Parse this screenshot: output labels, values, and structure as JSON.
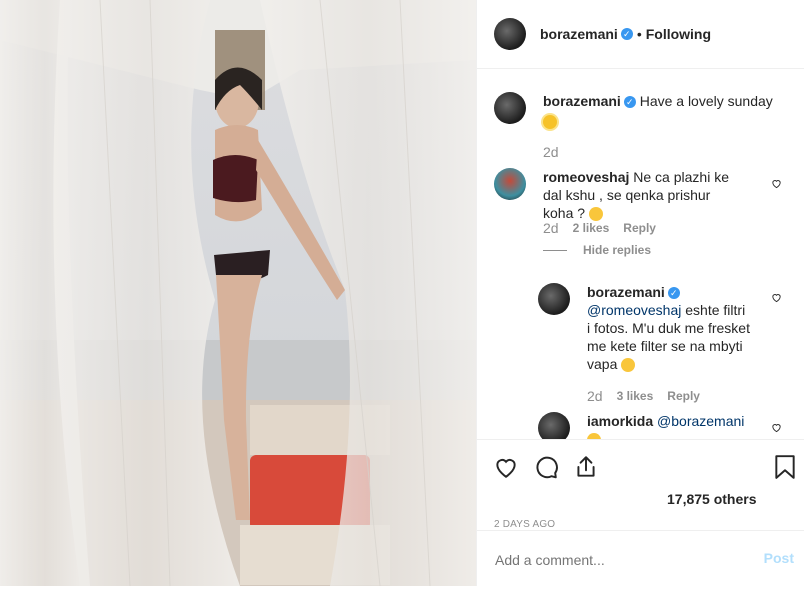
{
  "post": {
    "author": "borazemani",
    "follow_status": "Following",
    "separator": "•"
  },
  "caption": {
    "user": "borazemani",
    "text": "Have a lovely sunday",
    "time": "2d"
  },
  "comments": [
    {
      "user": "romeoveshaj",
      "text": "Ne ca plazhi ke dal kshu , se qenka prishur koha ?",
      "time": "2d",
      "likes": "2 likes",
      "reply_label": "Reply",
      "hide_replies": "Hide replies"
    }
  ],
  "replies": [
    {
      "user": "borazemani",
      "mention": "@romeoveshaj",
      "text": "eshte filtri i fotos. M'u duk me fresket me kete filter se na mbyti vapa",
      "time": "2d",
      "likes": "3 likes",
      "reply_label": "Reply"
    },
    {
      "user": "iamorkida",
      "mention": "@borazemani"
    }
  ],
  "stats": {
    "likes": "17,875 others",
    "date": "2 DAYS AGO"
  },
  "composer": {
    "placeholder": "Add a comment...",
    "post_label": "Post"
  },
  "icons": {
    "like": "heart-icon",
    "comment": "comment-icon",
    "share": "share-icon",
    "save": "bookmark-icon",
    "verified": "verified-badge-icon"
  },
  "colors": {
    "accent": "#3897f0",
    "muted": "#8e8e8e",
    "text": "#262626"
  }
}
